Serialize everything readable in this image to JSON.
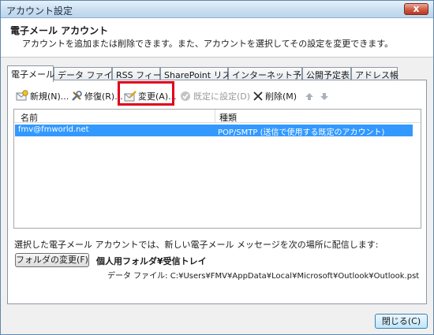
{
  "window": {
    "title": "アカウント設定",
    "close_symbol": "x"
  },
  "header": {
    "title": "電子メール アカウント",
    "description": "アカウントを追加または削除できます。また、アカウントを選択してその設定を変更できます。"
  },
  "tabs": [
    {
      "label": "電子メール",
      "active": true
    },
    {
      "label": "データ ファイル"
    },
    {
      "label": "RSS フィード"
    },
    {
      "label": "SharePoint リスト"
    },
    {
      "label": "インターネット予定表"
    },
    {
      "label": "公開予定表"
    },
    {
      "label": "アドレス帳"
    }
  ],
  "toolbar": {
    "new_label": "新規(N)...",
    "repair_label": "修復(R)...",
    "change_label": "変更(A)...",
    "set_default_label": "既定に設定(D)",
    "delete_label": "削除(M)",
    "icons": [
      "new-account-icon",
      "repair-icon",
      "change-icon",
      "set-default-icon",
      "delete-icon",
      "move-up-icon",
      "move-down-icon"
    ],
    "highlight_color": "#e0001a"
  },
  "list": {
    "columns": [
      "名前",
      "種類"
    ],
    "rows": [
      {
        "name": "fmv@fmworld.net",
        "type": "POP/SMTP (送信で使用する既定のアカウント)",
        "selected": true
      }
    ],
    "selection_color": "#3399ff"
  },
  "delivery": {
    "text": "選択した電子メール アカウントでは、新しい電子メール メッセージを次の場所に配信します:",
    "folder_button": "フォルダの変更(F)",
    "folder_name": "個人用フォルダ¥受信トレイ",
    "data_file": "データ ファイル: C:¥Users¥FMV¥AppData¥Local¥Microsoft¥Outlook¥Outlook.pst"
  },
  "footer": {
    "close_button": "閉じる(C)"
  }
}
